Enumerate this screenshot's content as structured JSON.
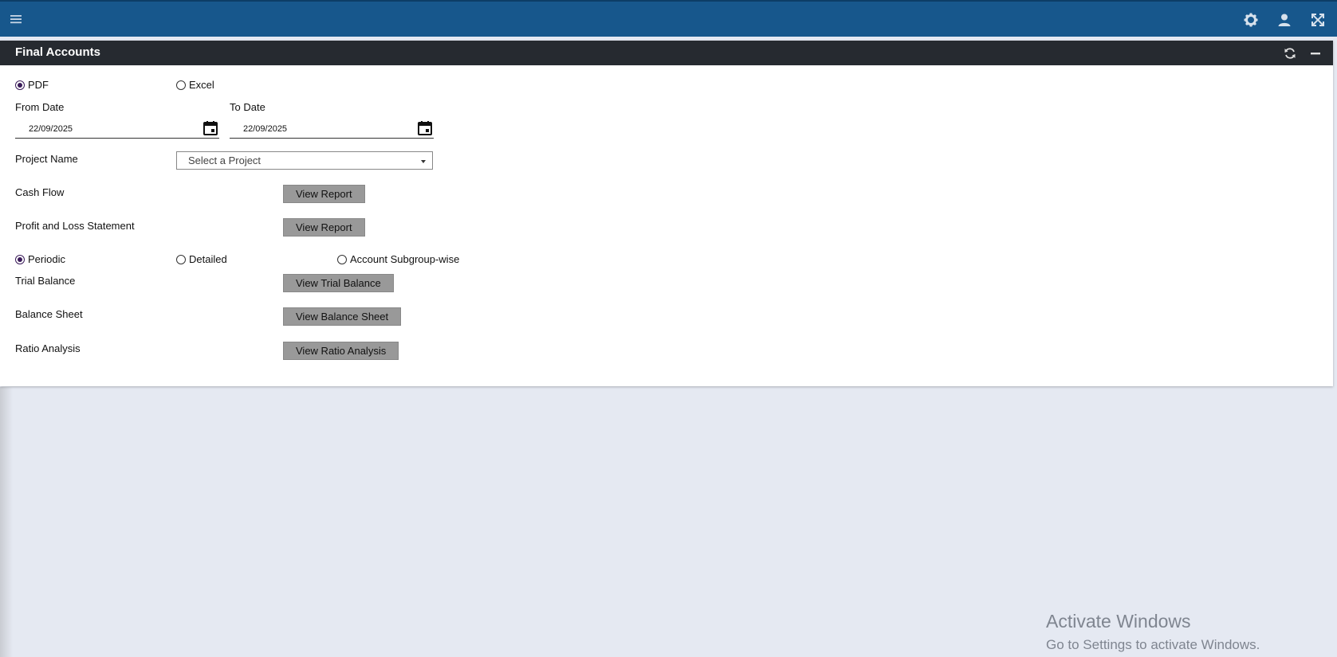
{
  "panel": {
    "title": "Final Accounts"
  },
  "format": {
    "pdf_label": "PDF",
    "excel_label": "Excel",
    "selected": "pdf"
  },
  "dates": {
    "from_label": "From Date",
    "from_value": "22/09/2025",
    "to_label": "To Date",
    "to_value": "22/09/2025"
  },
  "project": {
    "label": "Project Name",
    "placeholder": "Select a Project"
  },
  "reports": {
    "cash_flow_label": "Cash Flow",
    "cash_flow_button": "View Report",
    "pl_label": "Profit and Loss Statement",
    "pl_button": "View Report",
    "trial_balance_label": "Trial Balance",
    "trial_balance_button": "View Trial Balance",
    "balance_sheet_label": "Balance Sheet",
    "balance_sheet_button": "View Balance Sheet",
    "ratio_label": "Ratio Analysis",
    "ratio_button": "View Ratio Analysis"
  },
  "mode": {
    "periodic_label": "Periodic",
    "detailed_label": "Detailed",
    "subgroup_label": "Account Subgroup-wise",
    "selected": "periodic"
  },
  "watermark": {
    "line1": "Activate Windows",
    "line2": "Go to Settings to activate Windows."
  },
  "icons": {
    "menu": "hamburger-icon",
    "settings": "gear-icon",
    "user": "user-icon",
    "fullscreen": "expand-icon",
    "refresh": "refresh-icon",
    "minimize": "minimize-icon",
    "calendar": "calendar-icon"
  },
  "colors": {
    "topbar": "#17578c",
    "panel_header": "#262a30",
    "button": "#999999",
    "background": "#e5e9f2"
  }
}
